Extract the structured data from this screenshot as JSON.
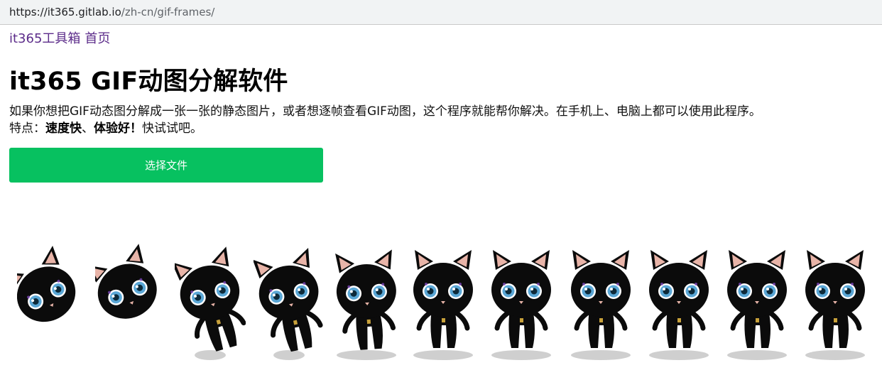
{
  "browser": {
    "url_host": "https://it365.gitlab.io",
    "url_path": "/zh-cn/gif-frames/"
  },
  "nav": {
    "site": "it365工具箱",
    "home": "首页"
  },
  "page": {
    "title": "it365 GIF动图分解软件",
    "description": "如果你想把GIF动态图分解成一张一张的静态图片，或者想逐帧查看GIF动图，这个程序就能帮你解决。在手机上、电脑上都可以使用此程序。",
    "features_prefix": "特点：",
    "feature_speed": "速度快",
    "feature_sep": "、",
    "feature_ux": "体验好",
    "feature_exclaim": "！",
    "features_suffix": "快试试吧。"
  },
  "actions": {
    "choose_file": "选择文件"
  },
  "frames": {
    "count": 11,
    "subject": "black-cat-frame",
    "colors": {
      "body": "#0b0b0b",
      "ear_inner": "#e8b4a8",
      "eye": "#5aa7d6",
      "shadow": "#cfcfcf",
      "accent": "#c8a13a",
      "highlight": "#8a4fd0"
    }
  }
}
